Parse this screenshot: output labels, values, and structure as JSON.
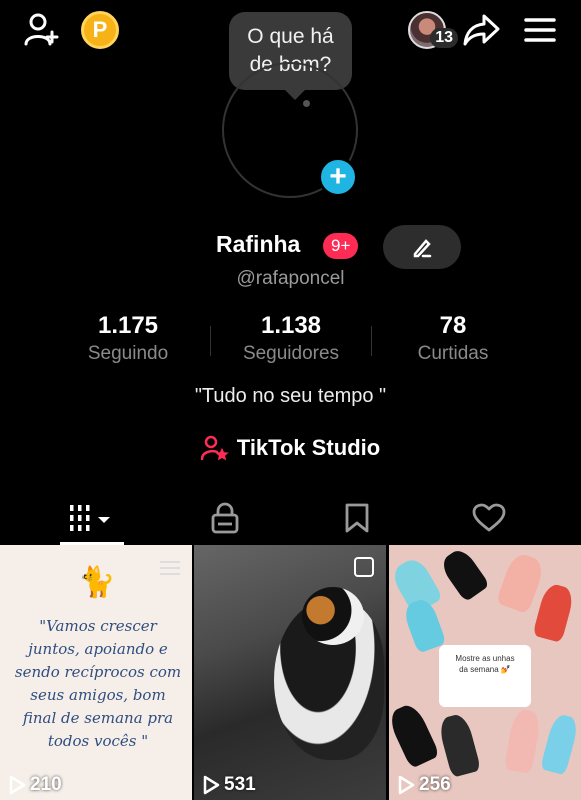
{
  "bubble": {
    "text_line1": "O que há",
    "text_line2": "de bom?"
  },
  "header": {
    "notification_count": "13"
  },
  "profile": {
    "name": "Rafinha",
    "badge": "9+",
    "handle": "@rafaponcel",
    "bio": "\"Tudo no seu tempo \""
  },
  "stats": [
    {
      "value": "1.175",
      "label": "Seguindo"
    },
    {
      "value": "1.138",
      "label": "Seguidores"
    },
    {
      "value": "78",
      "label": "Curtidas"
    }
  ],
  "studio": {
    "label": "TikTok Studio"
  },
  "videos": [
    {
      "views": "210",
      "quote": "\"Vamos crescer juntos, apoiando e sendo recíprocos com seus amigos, bom final de semana pra todos vocês \""
    },
    {
      "views": "531"
    },
    {
      "views": "256",
      "card_text1": "Mostre as unhas",
      "card_text2": "da semana 💅"
    }
  ],
  "colors": {
    "accent": "#fe2c55",
    "plus_blue": "#20b4e3",
    "coin": "#f7b218"
  }
}
